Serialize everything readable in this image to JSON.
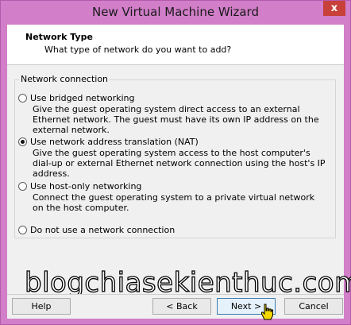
{
  "window": {
    "title": "New Virtual Machine Wizard",
    "close_glyph": "x"
  },
  "header": {
    "title": "Network Type",
    "subtitle": "What type of network do you want to add?"
  },
  "group": {
    "legend": "Network connection",
    "options": [
      {
        "label": "Use bridged networking",
        "description": "Give the guest operating system direct access to an external Ethernet network. The guest must have its own IP address on the external network.",
        "selected": false
      },
      {
        "label": "Use network address translation (NAT)",
        "description": "Give the guest operating system access to the host computer's dial-up or external Ethernet network connection using the host's IP address.",
        "selected": true
      },
      {
        "label": "Use host-only networking",
        "description": "Connect the guest operating system to a private virtual network on the host computer.",
        "selected": false
      },
      {
        "label": "Do not use a network connection",
        "description": "",
        "selected": false
      }
    ]
  },
  "watermark": "blogchiasekienthuc.com",
  "buttons": {
    "help": "Help",
    "back": "< Back",
    "next": "Next >",
    "cancel": "Cancel"
  },
  "icons": {
    "close": "close-icon",
    "cursor": "hand-pointer-icon",
    "radio": "radio-icon"
  },
  "colors": {
    "window_frame": "#d27ec9",
    "close_button": "#c7403a",
    "dialog_background": "#f0f0f0",
    "default_button_border": "#3c7fb1"
  }
}
